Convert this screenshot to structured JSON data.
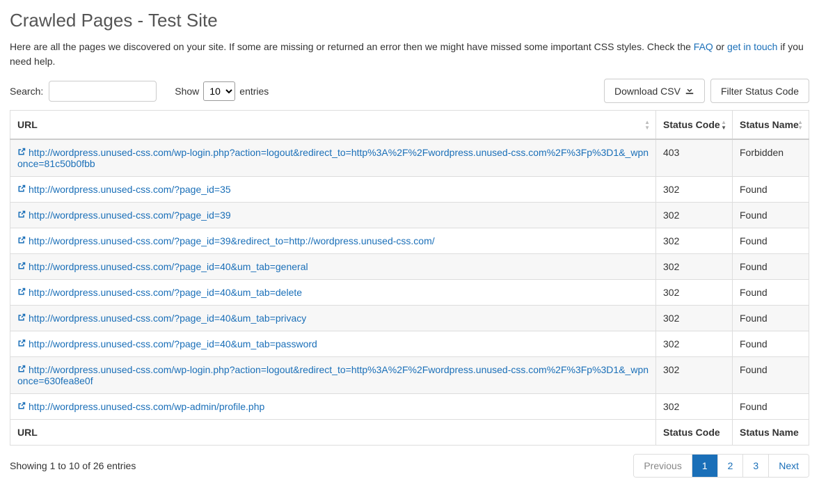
{
  "header": {
    "title": "Crawled Pages - Test Site"
  },
  "intro": {
    "text_before": "Here are all the pages we discovered on your site. If some are missing or returned an error then we might have missed some important CSS styles. Check the ",
    "faq_label": "FAQ",
    "text_mid": " or ",
    "get_in_touch_label": "get in touch",
    "text_after": " if you need help."
  },
  "controls": {
    "search_label": "Search:",
    "search_value": "",
    "show_label": "Show",
    "entries_label": "entries",
    "show_value": "10",
    "download_csv_label": "Download CSV",
    "filter_status_label": "Filter Status Code"
  },
  "table": {
    "headers": {
      "url": "URL",
      "status_code": "Status Code",
      "status_name": "Status Name"
    },
    "rows": [
      {
        "url": "http://wordpress.unused-css.com/wp-login.php?action=logout&redirect_to=http%3A%2F%2Fwordpress.unused-css.com%2F%3Fp%3D1&_wpnonce=81c50b0fbb",
        "code": "403",
        "name": "Forbidden"
      },
      {
        "url": "http://wordpress.unused-css.com/?page_id=35",
        "code": "302",
        "name": "Found"
      },
      {
        "url": "http://wordpress.unused-css.com/?page_id=39",
        "code": "302",
        "name": "Found"
      },
      {
        "url": "http://wordpress.unused-css.com/?page_id=39&redirect_to=http://wordpress.unused-css.com/",
        "code": "302",
        "name": "Found"
      },
      {
        "url": "http://wordpress.unused-css.com/?page_id=40&um_tab=general",
        "code": "302",
        "name": "Found"
      },
      {
        "url": "http://wordpress.unused-css.com/?page_id=40&um_tab=delete",
        "code": "302",
        "name": "Found"
      },
      {
        "url": "http://wordpress.unused-css.com/?page_id=40&um_tab=privacy",
        "code": "302",
        "name": "Found"
      },
      {
        "url": "http://wordpress.unused-css.com/?page_id=40&um_tab=password",
        "code": "302",
        "name": "Found"
      },
      {
        "url": "http://wordpress.unused-css.com/wp-login.php?action=logout&redirect_to=http%3A%2F%2Fwordpress.unused-css.com%2F%3Fp%3D1&_wpnonce=630fea8e0f",
        "code": "302",
        "name": "Found"
      },
      {
        "url": "http://wordpress.unused-css.com/wp-admin/profile.php",
        "code": "302",
        "name": "Found"
      }
    ],
    "footers": {
      "url": "URL",
      "status_code": "Status Code",
      "status_name": "Status Name"
    }
  },
  "footer": {
    "showing": "Showing 1 to 10 of 26 entries"
  },
  "pagination": {
    "previous": "Previous",
    "pages": [
      "1",
      "2",
      "3"
    ],
    "active_index": 0,
    "next": "Next"
  }
}
